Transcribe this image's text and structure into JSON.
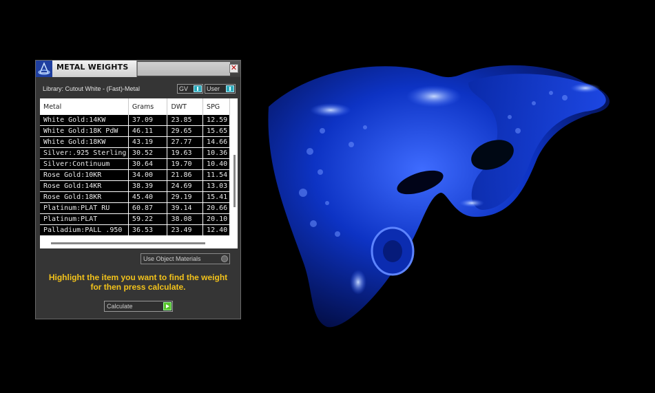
{
  "panel": {
    "title": "METAL WEIGHTS",
    "close_glyph": "✕",
    "library_label": "Library: Cutout White - (Fast)-Metal",
    "toggles": [
      {
        "label": "GV",
        "state": "on"
      },
      {
        "label": "User",
        "state": "on"
      }
    ]
  },
  "table": {
    "columns": [
      "Metal",
      "Grams",
      "DWT",
      "SPG"
    ],
    "rows": [
      {
        "metal": "White Gold:14KW",
        "grams": "37.09",
        "dwt": "23.85",
        "spg": "12.59"
      },
      {
        "metal": "White Gold:18K PdW",
        "grams": "46.11",
        "dwt": "29.65",
        "spg": "15.65"
      },
      {
        "metal": "White Gold:18KW",
        "grams": "43.19",
        "dwt": "27.77",
        "spg": "14.66"
      },
      {
        "metal": "Silver:.925 Sterling",
        "grams": "30.52",
        "dwt": "19.63",
        "spg": "10.36"
      },
      {
        "metal": "Silver:Continuum",
        "grams": "30.64",
        "dwt": "19.70",
        "spg": "10.40"
      },
      {
        "metal": "Rose Gold:10KR",
        "grams": "34.00",
        "dwt": "21.86",
        "spg": "11.54"
      },
      {
        "metal": "Rose Gold:14KR",
        "grams": "38.39",
        "dwt": "24.69",
        "spg": "13.03"
      },
      {
        "metal": "Rose Gold:18KR",
        "grams": "45.40",
        "dwt": "29.19",
        "spg": "15.41"
      },
      {
        "metal": "Platinum:PLAT RU",
        "grams": "60.87",
        "dwt": "39.14",
        "spg": "20.66"
      },
      {
        "metal": "Platinum:PLAT",
        "grams": "59.22",
        "dwt": "38.08",
        "spg": "20.10"
      },
      {
        "metal": "Palladium:PALL .950",
        "grams": "36.53",
        "dwt": "23.49",
        "spg": "12.40"
      }
    ]
  },
  "materials_dropdown": {
    "selected": "Use Object Materials"
  },
  "instructions": {
    "line1": "Highlight the item you want to find the weight",
    "line2": "for then press calculate."
  },
  "calculate_button": {
    "label": "Calculate"
  },
  "colors": {
    "accent_text": "#f2c21b",
    "model_blue": "#0a2fb8",
    "toggle_on": "#2aa8b8",
    "calc_arrow": "#58c229"
  },
  "icons": [
    "app-logo-icon",
    "close-icon",
    "dropdown-arrow-icon",
    "play-arrow-icon"
  ]
}
